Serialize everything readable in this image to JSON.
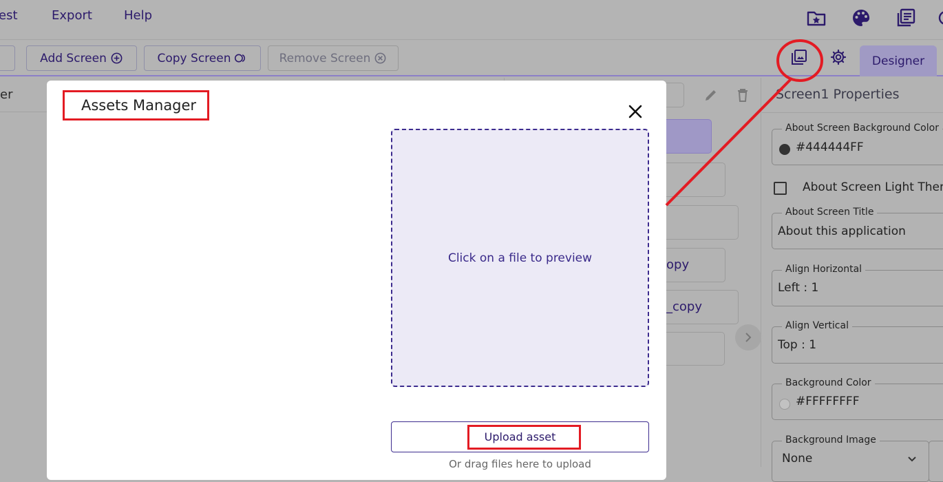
{
  "menu": {
    "items": [
      "est",
      "Export",
      "Help"
    ]
  },
  "toolbar": {
    "add_screen": "Add Screen",
    "copy_screen": "Copy Screen",
    "remove_screen": "Remove Screen",
    "designer_tab": "Designer"
  },
  "left_panel": {
    "header_fragment": "er"
  },
  "middle_panel": {
    "item_fragment_1": "opy",
    "item_fragment_2": "_copy"
  },
  "properties": {
    "title": "Screen1 Properties",
    "about_bg_color_label": "About Screen Background Color",
    "about_bg_color_value": "#444444FF",
    "light_theme_label": "About Screen Light Theme",
    "about_title_label": "About Screen Title",
    "about_title_value": "About this application",
    "align_h_label": "Align Horizontal",
    "align_h_value": "Left : 1",
    "align_v_label": "Align Vertical",
    "align_v_value": "Top : 1",
    "bg_color_label": "Background Color",
    "bg_color_value": "#FFFFFFFF",
    "bg_image_label": "Background Image",
    "bg_image_value": "None"
  },
  "modal": {
    "title": "Assets Manager",
    "preview_text": "Click on a file to preview",
    "upload_button": "Upload asset",
    "drag_hint": "Or drag files here to upload"
  },
  "colors": {
    "accent": "#2c1a6b",
    "annotation_red": "#e31b23",
    "preview_bg": "#eceaf6",
    "about_swatch": "#333333",
    "bg_swatch": "#ffffff"
  },
  "icons": [
    "folder-star-icon",
    "palette-icon",
    "library-icon",
    "assets-icon",
    "gear-icon",
    "close-icon",
    "pencil-icon",
    "trash-icon"
  ]
}
